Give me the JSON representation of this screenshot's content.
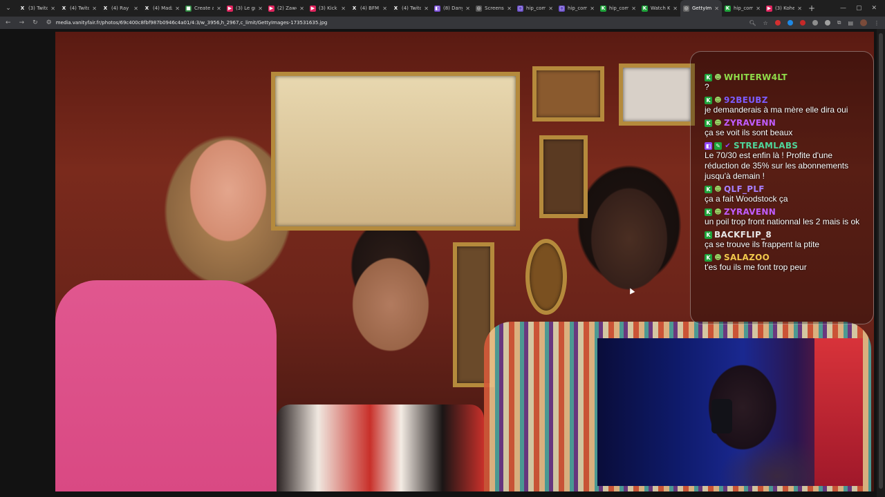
{
  "browser": {
    "tabs": [
      {
        "title": "(3) Twitch",
        "icon": "x-icon",
        "color": "#222222",
        "glyph": "X"
      },
      {
        "title": "(4) Twitch",
        "icon": "x-icon",
        "color": "#222222",
        "glyph": "X"
      },
      {
        "title": "(4) Ray",
        "icon": "x-icon",
        "color": "#222222",
        "glyph": "X"
      },
      {
        "title": "(4) Madz",
        "icon": "x-icon",
        "color": "#222222",
        "glyph": "X"
      },
      {
        "title": "Create a",
        "icon": "doc-icon",
        "color": "#2b8a3e",
        "glyph": "■"
      },
      {
        "title": "(3) Le gr",
        "icon": "youtube-icon",
        "color": "#e0245e",
        "glyph": "▶"
      },
      {
        "title": "(2) Zawo",
        "icon": "youtube-icon",
        "color": "#e0245e",
        "glyph": "▶"
      },
      {
        "title": "(3) Kick",
        "icon": "youtube-icon",
        "color": "#e0245e",
        "glyph": "▶"
      },
      {
        "title": "(4) BFM",
        "icon": "x-icon",
        "color": "#222222",
        "glyph": "X"
      },
      {
        "title": "(4) Twitch",
        "icon": "x-icon",
        "color": "#222222",
        "glyph": "X"
      },
      {
        "title": "(8) Dany",
        "icon": "twitch-icon",
        "color": "#7a4dd8",
        "glyph": "◧"
      },
      {
        "title": "Screensh",
        "icon": "globe-icon",
        "color": "#555555",
        "glyph": "◎"
      },
      {
        "title": "hip_com",
        "icon": "doc-icon",
        "color": "#6a4fc8",
        "glyph": "▢"
      },
      {
        "title": "hip_com",
        "icon": "doc-icon",
        "color": "#6a4fc8",
        "glyph": "▢"
      },
      {
        "title": "hip_com",
        "icon": "kick-icon",
        "color": "#1fa33b",
        "glyph": "K"
      },
      {
        "title": "Watch K",
        "icon": "kick-icon",
        "color": "#1fa33b",
        "glyph": "K"
      },
      {
        "title": "GettyIm",
        "icon": "globe-icon",
        "color": "#666666",
        "glyph": "◎",
        "active": true
      },
      {
        "title": "hip_com",
        "icon": "kick-icon",
        "color": "#1fa33b",
        "glyph": "K"
      },
      {
        "title": "(3) Kohe",
        "icon": "youtube-icon",
        "color": "#e0245e",
        "glyph": "▶"
      }
    ],
    "url": "media.vanityfair.fr/photos/69c400c8fbf987b0946c4a01/4:3/w_3956,h_2967,c_limit/GettyImages-173531635.jpg"
  },
  "chat": {
    "messages": [
      {
        "user": "WHITERW4LT",
        "color": "#8fdc4a",
        "badges": [
          "kick",
          "skull"
        ],
        "text": "?"
      },
      {
        "user": "92BEUBZ",
        "color": "#7d5cff",
        "badges": [
          "kick",
          "skull"
        ],
        "text": "je demanderais à ma mère elle dira oui"
      },
      {
        "user": "ZYRAVENN",
        "color": "#c05cff",
        "badges": [
          "kick",
          "skull"
        ],
        "text": "ça se voit ils sont beaux"
      },
      {
        "user": "STREAMLABS",
        "color": "#4fd59a",
        "badges": [
          "twitch",
          "pencil",
          "verified"
        ],
        "text": "Le 70/30 est enfin là ! Profite d'une réduction de 35% sur les abonnements jusqu'à demain !"
      },
      {
        "user": "QLF_PLF",
        "color": "#a880ff",
        "badges": [
          "kick",
          "skull"
        ],
        "text": "ça a fait Woodstock ça"
      },
      {
        "user": "ZYRAVENN",
        "color": "#c05cff",
        "badges": [
          "kick",
          "skull"
        ],
        "text": "un poil trop front nationnal les 2 mais is ok"
      },
      {
        "user": "BACKFLIP_8",
        "color": "#e8e8e8",
        "badges": [
          "kick"
        ],
        "text": "ça se trouve ils frappent la ptite"
      },
      {
        "user": "SALAZOO",
        "color": "#f2c94c",
        "badges": [
          "kick",
          "skull"
        ],
        "text": "t'es fou ils me font trop peur"
      }
    ]
  }
}
